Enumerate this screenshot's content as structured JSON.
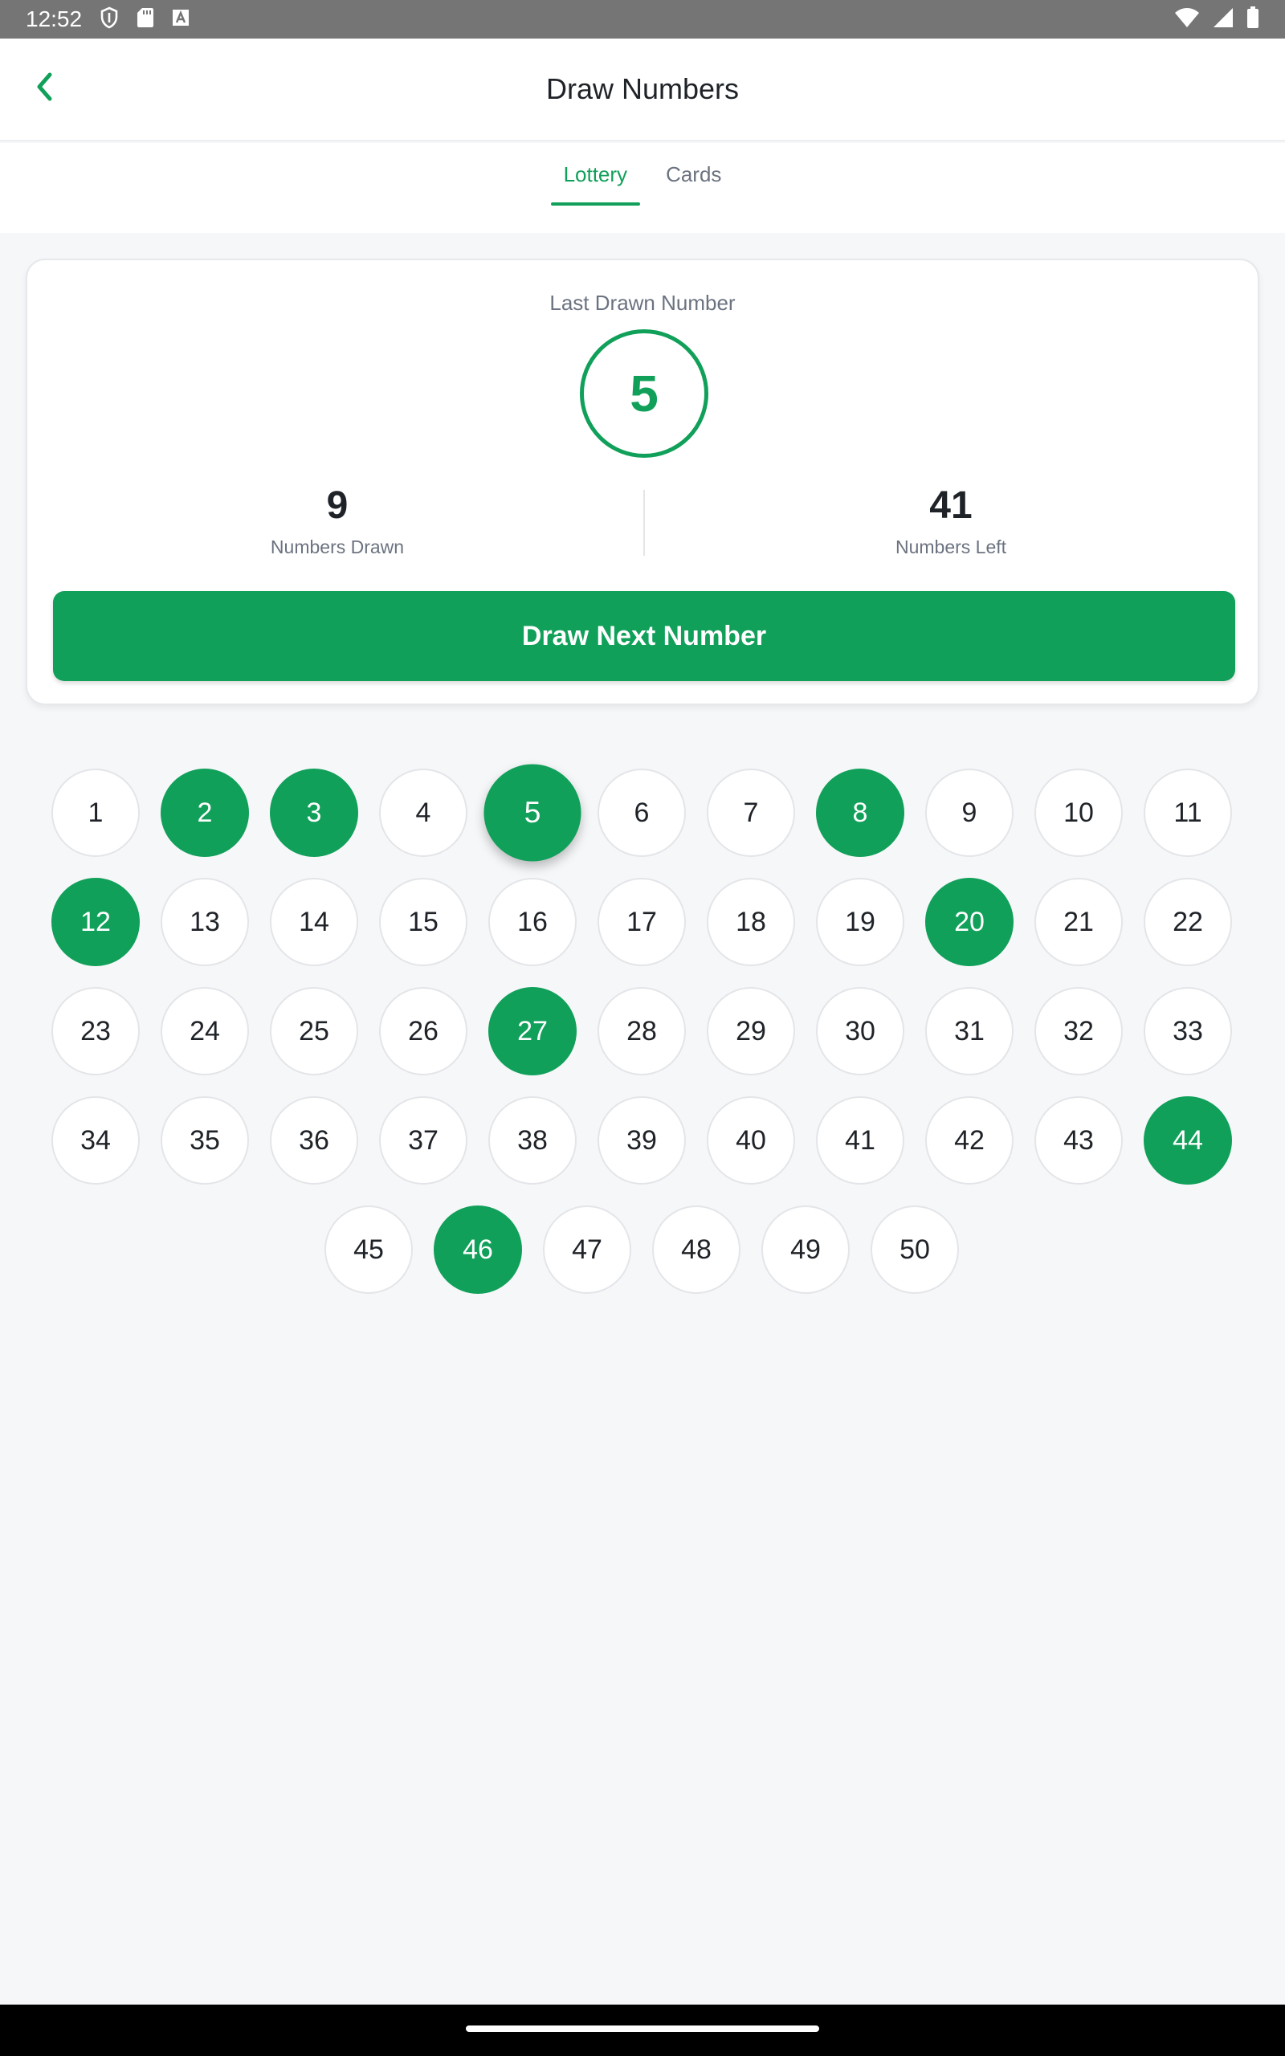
{
  "status_bar": {
    "time": "12:52",
    "left_icons": [
      "shield-icon",
      "sd-card-icon",
      "text-a-icon"
    ],
    "right_icons": [
      "wifi-icon",
      "signal-icon",
      "battery-icon"
    ]
  },
  "app_bar": {
    "title": "Draw Numbers",
    "back_icon": "chevron-left-icon"
  },
  "tabs": [
    {
      "label": "Lottery",
      "active": true
    },
    {
      "label": "Cards",
      "active": false
    }
  ],
  "summary": {
    "last_drawn_label": "Last Drawn Number",
    "last_drawn_value": "5",
    "numbers_drawn_value": "9",
    "numbers_drawn_label": "Numbers Drawn",
    "numbers_left_value": "41",
    "numbers_left_label": "Numbers Left",
    "draw_button_label": "Draw Next Number"
  },
  "grid": {
    "total": 50,
    "per_row": 11,
    "drawn": [
      2,
      3,
      5,
      8,
      12,
      20,
      27,
      44,
      46
    ],
    "latest": 5
  },
  "colors": {
    "accent": "#11a05a",
    "status_bar": "#757575",
    "background": "#f6f7f9",
    "muted_text": "#6b7280"
  }
}
